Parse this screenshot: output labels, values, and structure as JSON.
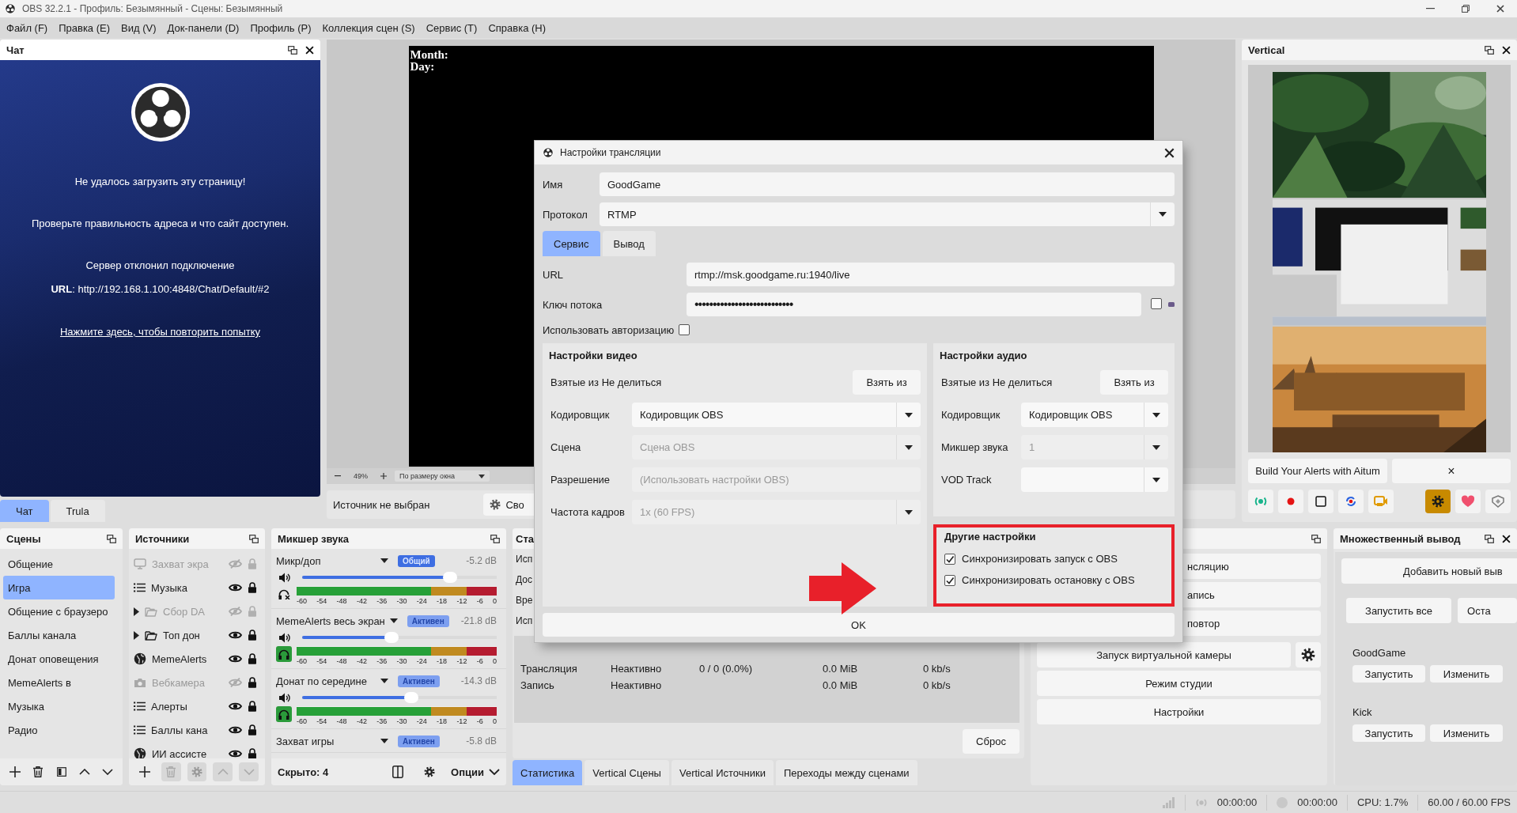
{
  "window": {
    "title": "OBS 32.2.1 - Профиль: Безымянный - Сцены: Безымянный"
  },
  "menu": [
    "Файл (F)",
    "Правка (E)",
    "Вид (V)",
    "Док-панели (D)",
    "Профиль (P)",
    "Коллекция сцен (S)",
    "Сервис (T)",
    "Справка (H)"
  ],
  "chat_dock": {
    "title": "Чат",
    "error_title": "Не удалось загрузить эту страницу!",
    "hint": "Проверьте правильность адреса и что сайт доступен.",
    "reason": "Сервер отклонил подключение",
    "url": "**URL**: http://192.168.1.100:4848/Chat/Default/#2",
    "retry_link": "Нажмите здесь, чтобы повторить попытку",
    "tabs": [
      {
        "label": "Чат",
        "selected": true
      },
      {
        "label": "Trula",
        "selected": false
      }
    ]
  },
  "preview": {
    "overlay_lines": [
      "Month:",
      "Day:"
    ],
    "zoom": "49%",
    "fit_mode": "По размеру окна",
    "source_status": "Источник не выбран",
    "properties_button": "Сво"
  },
  "vertical_dock": {
    "title": "Vertical",
    "alerts_button": "Build Your Alerts with Aitum",
    "dismiss_button": "×",
    "toolbar": [
      {
        "kind": "broadcast",
        "active": false
      },
      {
        "kind": "record",
        "active": false
      },
      {
        "kind": "square",
        "active": false
      },
      {
        "kind": "replay",
        "active": false
      },
      {
        "kind": "camera",
        "active": false
      },
      {
        "kind": "gear",
        "active": true
      },
      {
        "kind": "heart",
        "active": false
      },
      {
        "kind": "shield",
        "active": false
      }
    ]
  },
  "scenes_dock": {
    "title": "Сцены",
    "items": [
      {
        "label": "Общение",
        "selected": false
      },
      {
        "label": "Игра",
        "selected": true
      },
      {
        "label": "Общение с браузеро",
        "selected": false
      },
      {
        "label": "Баллы канала",
        "selected": false
      },
      {
        "label": "Донат оповещения",
        "selected": false
      },
      {
        "label": "MemeAlerts в",
        "selected": false
      },
      {
        "label": "Музыка",
        "selected": false
      },
      {
        "label": "Радио",
        "selected": false
      }
    ]
  },
  "sources_dock": {
    "title": "Источники",
    "items": [
      {
        "label": "Захват экра",
        "kind": "display",
        "visible": false,
        "locked": false
      },
      {
        "label": "Музыка",
        "kind": "list",
        "visible": true,
        "locked": true
      },
      {
        "label": "Сбор DA",
        "kind": "folder",
        "visible": false,
        "locked": false,
        "expanded": false
      },
      {
        "label": "Топ дон",
        "kind": "folder",
        "visible": true,
        "locked": true,
        "expanded": false
      },
      {
        "label": "MemeAlerts",
        "kind": "globe",
        "visible": true,
        "locked": true
      },
      {
        "label": "Вебкамера",
        "kind": "camera",
        "visible": false,
        "locked": true
      },
      {
        "label": "Алерты",
        "kind": "list",
        "visible": true,
        "locked": true
      },
      {
        "label": "Баллы кана",
        "kind": "list",
        "visible": true,
        "locked": true
      },
      {
        "label": "ИИ ассисте",
        "kind": "globe",
        "visible": true,
        "locked": true
      }
    ]
  },
  "mixer_dock": {
    "title": "Микшер звука",
    "hidden_count": "Скрыто: 4",
    "options_button": "Опции",
    "channels": [
      {
        "name": "Микр/доп",
        "badge": "Общий",
        "kind": "global",
        "reading": "-5.2 dB",
        "level": 0.76,
        "monitoring": false,
        "ticks": [
          "-60",
          "-54",
          "-48",
          "-42",
          "-36",
          "-30",
          "-24",
          "-18",
          "-12",
          "-6",
          "0"
        ]
      },
      {
        "name": "MemeAlerts весь экран",
        "badge": "Активен",
        "kind": "active",
        "reading": "-21.8 dB",
        "level": 0.46,
        "monitoring": true,
        "ticks": [
          "-60",
          "-54",
          "-48",
          "-42",
          "-36",
          "-30",
          "-24",
          "-18",
          "-12",
          "-6",
          "0"
        ]
      },
      {
        "name": "Донат по середине",
        "badge": "Активен",
        "kind": "active",
        "reading": "-14.3 dB",
        "level": 0.56,
        "monitoring": true,
        "ticks": [
          "-60",
          "-54",
          "-48",
          "-42",
          "-36",
          "-30",
          "-24",
          "-18",
          "-12",
          "-6",
          "0"
        ]
      },
      {
        "name": "Захват игры",
        "badge": "Активен",
        "kind": "active",
        "reading": "-5.8 dB"
      }
    ]
  },
  "stats_dock": {
    "title": "Ста",
    "labels": [
      "Исп",
      "Дос",
      "Вре",
      "Исп"
    ],
    "rows": [
      {
        "column_1": "Трансляция",
        "column_2": "Неактивно",
        "column_3": "0 / 0 (0.0%)",
        "column_4": "0.0 MiB",
        "column_5": "0 kb/s"
      },
      {
        "column_1": "Запись",
        "column_2": "Неактивно",
        "column_4": "0.0 MiB",
        "column_5": "0 kb/s"
      }
    ],
    "reset_button": "Сброс",
    "tabs": [
      {
        "label": "Статистика",
        "selected": true
      },
      {
        "label": "Vertical Сцены",
        "selected": false
      },
      {
        "label": "Vertical Источники",
        "selected": false
      },
      {
        "label": "Переходы между сценами",
        "selected": false
      }
    ]
  },
  "controls_dock": {
    "buttons": [
      "нсляцию",
      "апись",
      "повтор"
    ],
    "virtual_camera_button": "Запуск виртуальной камеры",
    "studio_mode_button": "Режим студии",
    "settings_button": "Настройки"
  },
  "multi_output_dock": {
    "title": "Множественный вывод",
    "add_button": "Добавить новый выв",
    "start_all_button": "Запустить все",
    "stop_all_button": "Оста",
    "outputs": [
      {
        "name": "GoodGame",
        "start_button": "Запустить",
        "edit_button": "Изменить"
      },
      {
        "name": "Kick",
        "start_button": "Запустить",
        "edit_button": "Изменить"
      }
    ]
  },
  "status_bar": {
    "stream_time": "00:00:00",
    "record_time": "00:00:00",
    "cpu": "CPU: 1.7%",
    "fps": "60.00 / 60.00 FPS"
  },
  "dialog": {
    "title": "Настройки трансляции",
    "name": {
      "label": "Имя",
      "value": "GoodGame"
    },
    "protocol": {
      "label": "Протокол",
      "value": "RTMP"
    },
    "tabs": [
      {
        "label": "Сервис",
        "selected": true
      },
      {
        "label": "Вывод",
        "selected": false
      }
    ],
    "url": {
      "label": "URL",
      "value": "rtmp://msk.goodgame.ru:1940/live"
    },
    "stream_key": {
      "label": "Ключ потока",
      "value": "•••••••••••••••••••••••••••",
      "show_checked": false
    },
    "use_auth": {
      "label": "Использовать авторизацию",
      "checked": false
    },
    "video": {
      "title": "Настройки видео",
      "inherit_text": "Взятые из Не делиться",
      "inherit_button": "Взять из",
      "rows": [
        {
          "label": "Кодировщик",
          "kind": "select",
          "value": "Кодировщик OBS",
          "disabled": false
        },
        {
          "label": "Сцена",
          "kind": "select",
          "value": "Сцена OBS",
          "disabled": true
        },
        {
          "label": "Разрешение",
          "kind": "text",
          "placeholder": "(Использовать настройки OBS)",
          "disabled": true
        },
        {
          "label": "Частота кадров",
          "kind": "select",
          "value": "1x (60 FPS)",
          "disabled": true
        }
      ]
    },
    "audio": {
      "title": "Настройки аудио",
      "inherit_text": "Взятые из Не делиться",
      "inherit_button": "Взять из",
      "rows": [
        {
          "label": "Кодировщик",
          "kind": "select",
          "value": "Кодировщик OBS",
          "disabled": false
        },
        {
          "label": "Микшер звука",
          "kind": "select",
          "value": "1",
          "disabled": true
        },
        {
          "label": "VOD Track",
          "kind": "select"
        }
      ]
    },
    "other": {
      "title": "Другие настройки",
      "options": [
        {
          "label": "Синхронизировать запуск с OBS",
          "checked": true
        },
        {
          "label": "Синхронизировать остановку с OBS",
          "checked": true
        }
      ]
    },
    "ok_button": "OK"
  }
}
